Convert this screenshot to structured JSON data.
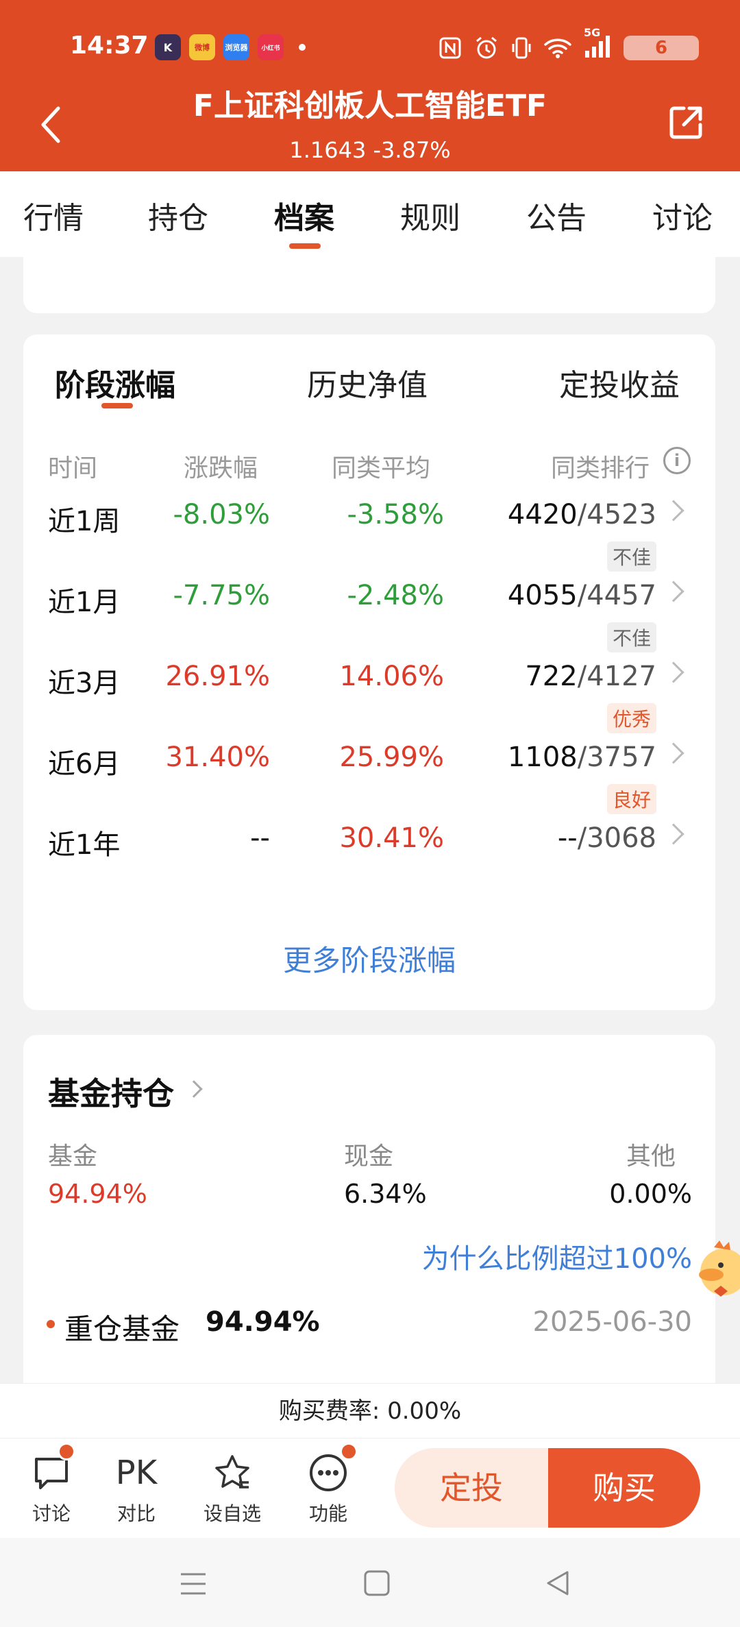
{
  "status_bar": {
    "time": "14:37",
    "network": "5G",
    "battery": "6",
    "app_icons": [
      "K",
      "微博",
      "浏览器",
      "小红书"
    ]
  },
  "header": {
    "title": "F上证科创板人工智能ETF",
    "nav_value": "1.1643 -3.87%",
    "back_icon": "chevron-left-icon",
    "share_icon": "share-icon"
  },
  "tabs": [
    "行情",
    "持仓",
    "档案",
    "规则",
    "公告",
    "讨论"
  ],
  "active_tab": "档案",
  "stage": {
    "segments": [
      "阶段涨幅",
      "历史净值",
      "定投收益"
    ],
    "active_segment": "阶段涨幅",
    "headers": {
      "period": "时间",
      "change": "涨跌幅",
      "peer_avg": "同类平均",
      "peer_rank": "同类排行"
    },
    "rows": [
      {
        "period": "近1周",
        "change": "-8.03%",
        "avg": "-3.58%",
        "rank": "4420",
        "total": "/4523",
        "badge": "不佳"
      },
      {
        "period": "近1月",
        "change": "-7.75%",
        "avg": "-2.48%",
        "rank": "4055",
        "total": "/4457",
        "badge": "不佳"
      },
      {
        "period": "近3月",
        "change": "26.91%",
        "avg": "14.06%",
        "rank": "722",
        "total": "/4127",
        "badge": "优秀"
      },
      {
        "period": "近6月",
        "change": "31.40%",
        "avg": "25.99%",
        "rank": "1108",
        "total": "/3757",
        "badge": "良好"
      },
      {
        "period": "近1年",
        "change": "--",
        "avg": "30.41%",
        "rank": "--",
        "total": "/3068",
        "badge": ""
      }
    ],
    "more_link": "更多阶段涨幅"
  },
  "holdings": {
    "title": "基金持仓",
    "labels": {
      "fund": "基金",
      "cash": "现金",
      "other": "其他"
    },
    "values": {
      "fund": "94.94%",
      "cash": "6.34%",
      "other": "0.00%"
    },
    "why_link": "为什么比例超过100%",
    "heavy_label": "重仓基金",
    "heavy_value": "94.94%",
    "heavy_date": "2025-06-30"
  },
  "fee": "购买费率: 0.00%",
  "action_bar": {
    "discuss": "讨论",
    "pk_icon_text": "PK",
    "compare": "对比",
    "watchlist": "设自选",
    "functions": "功能",
    "fixed_invest": "定投",
    "buy": "购买"
  },
  "colors": {
    "brand": "#dd4a24",
    "up": "#dd3a2a",
    "down": "#2e9e3a",
    "link": "#3f7fd8"
  }
}
